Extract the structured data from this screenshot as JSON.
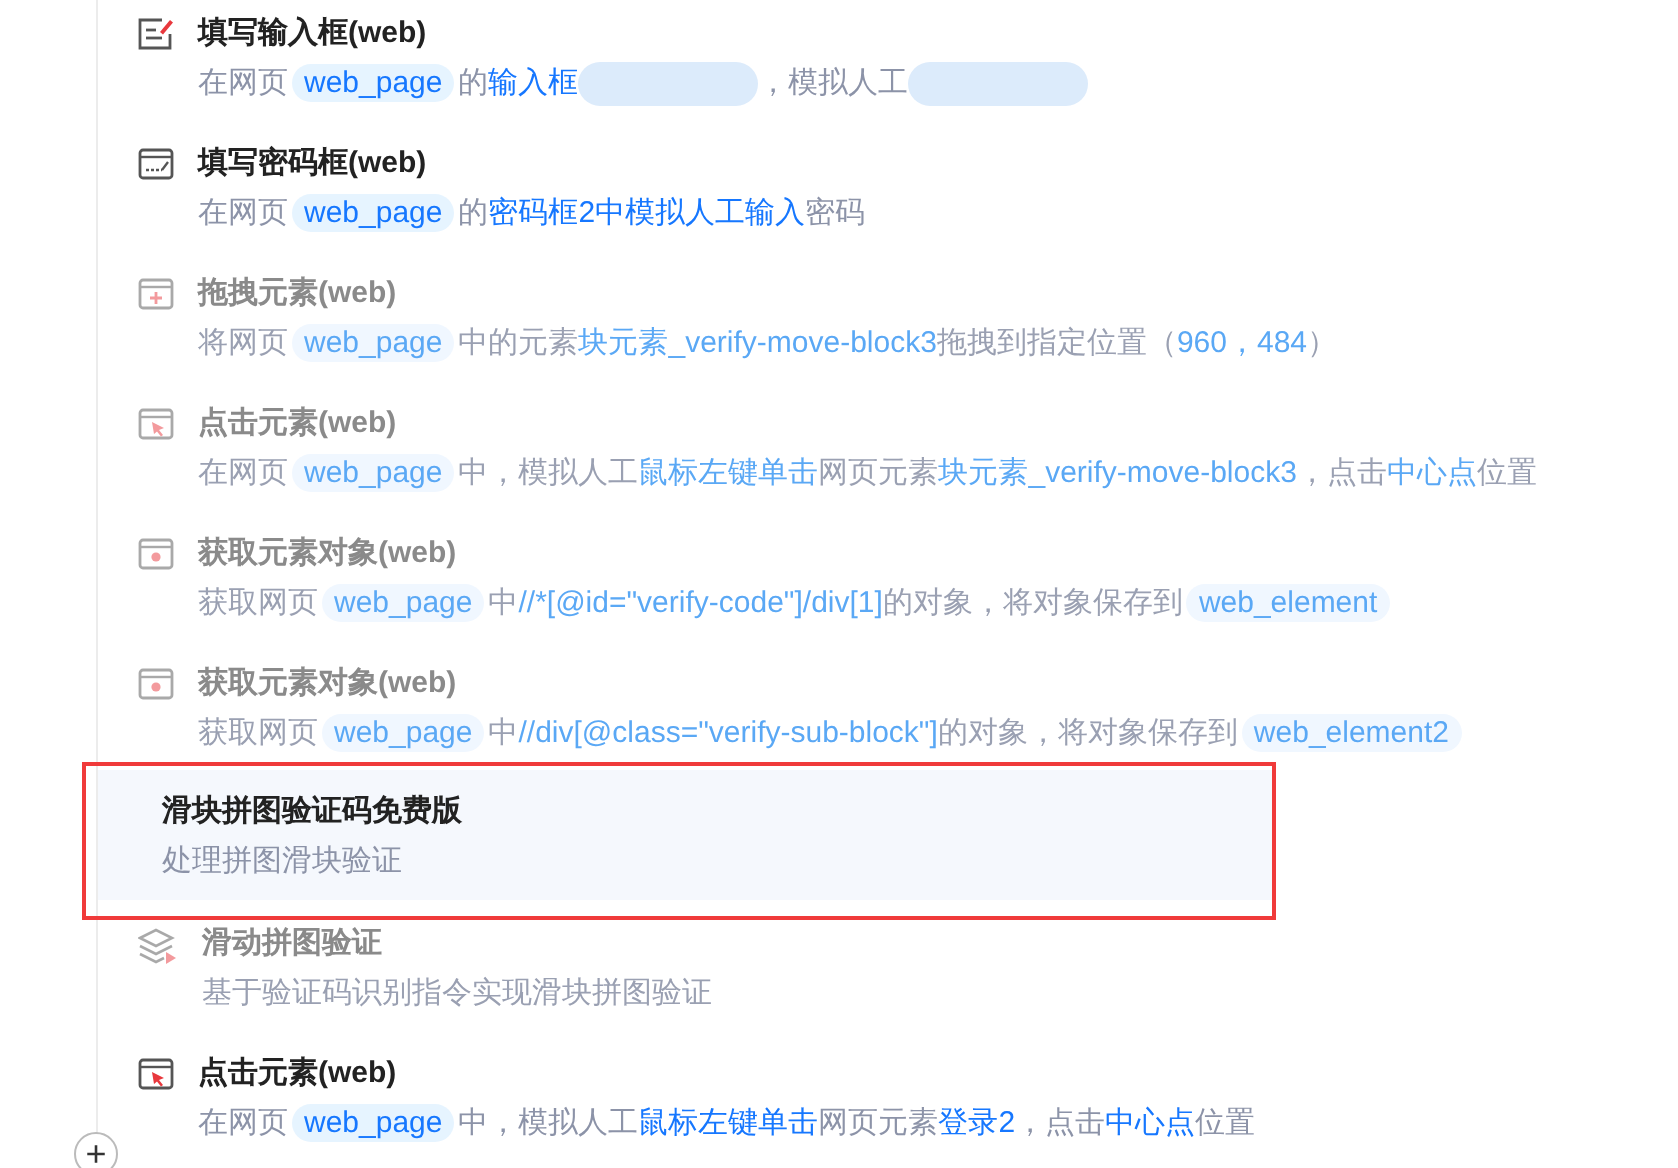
{
  "steps": [
    {
      "kind": "input",
      "title": "填写输入框(web)",
      "disabled": false,
      "selected": false,
      "annotated": false,
      "description": [
        {
          "kind": "text",
          "text": "在网页"
        },
        {
          "kind": "chip",
          "text": "web_page"
        },
        {
          "kind": "text",
          "text": "的"
        },
        {
          "kind": "link",
          "text": "输入框"
        },
        {
          "kind": "blur"
        },
        {
          "kind": "text",
          "text": "，模拟人工"
        },
        {
          "kind": "blur"
        }
      ]
    },
    {
      "kind": "password",
      "title": "填写密码框(web)",
      "disabled": false,
      "selected": false,
      "annotated": false,
      "description": [
        {
          "kind": "text",
          "text": "在网页"
        },
        {
          "kind": "chip",
          "text": "web_page"
        },
        {
          "kind": "text",
          "text": "的"
        },
        {
          "kind": "link",
          "text": "密码框2中模拟人工输入"
        },
        {
          "kind": "text",
          "text": "密码"
        }
      ]
    },
    {
      "kind": "drag",
      "title": "拖拽元素(web)",
      "disabled": true,
      "selected": false,
      "annotated": false,
      "description": [
        {
          "kind": "text",
          "text": "将网页"
        },
        {
          "kind": "chip",
          "text": "web_page"
        },
        {
          "kind": "text",
          "text": "中的元素"
        },
        {
          "kind": "link",
          "text": "块元素_verify-move-block3"
        },
        {
          "kind": "text",
          "text": "拖拽到指定位置（"
        },
        {
          "kind": "link",
          "text": "960，484"
        },
        {
          "kind": "text",
          "text": "）"
        }
      ]
    },
    {
      "kind": "click",
      "title": "点击元素(web)",
      "disabled": true,
      "selected": false,
      "annotated": false,
      "description": [
        {
          "kind": "text",
          "text": "在网页"
        },
        {
          "kind": "chip",
          "text": "web_page"
        },
        {
          "kind": "text",
          "text": "中，模拟人工"
        },
        {
          "kind": "link",
          "text": "鼠标左键单击"
        },
        {
          "kind": "text",
          "text": "网页元素"
        },
        {
          "kind": "link",
          "text": "块元素_verify-move-block3"
        },
        {
          "kind": "text",
          "text": "，点击"
        },
        {
          "kind": "link",
          "text": "中心点"
        },
        {
          "kind": "text",
          "text": "位置"
        }
      ]
    },
    {
      "kind": "element",
      "title": "获取元素对象(web)",
      "disabled": true,
      "selected": false,
      "annotated": false,
      "description": [
        {
          "kind": "text",
          "text": "获取网页"
        },
        {
          "kind": "chip",
          "text": "web_page"
        },
        {
          "kind": "text",
          "text": "中"
        },
        {
          "kind": "link",
          "text": "//*[@id=\"verify-code\"]/div[1]"
        },
        {
          "kind": "text",
          "text": "的对象，将对象保存到"
        },
        {
          "kind": "chip",
          "text": "web_element"
        }
      ]
    },
    {
      "kind": "element",
      "title": "获取元素对象(web)",
      "disabled": true,
      "selected": false,
      "annotated": false,
      "description": [
        {
          "kind": "text",
          "text": "获取网页"
        },
        {
          "kind": "chip",
          "text": "web_page"
        },
        {
          "kind": "text",
          "text": "中"
        },
        {
          "kind": "link",
          "text": "//div[@class=\"verify-sub-block\"]"
        },
        {
          "kind": "text",
          "text": "的对象，将对象保存到"
        },
        {
          "kind": "chip",
          "text": "web_element2"
        }
      ]
    },
    {
      "kind": "none",
      "title": "滑块拼图验证码免费版",
      "disabled": false,
      "selected": true,
      "annotated": true,
      "description": [
        {
          "kind": "text",
          "text": "处理拼图滑块验证"
        }
      ]
    },
    {
      "kind": "layers",
      "title": "滑动拼图验证",
      "disabled": true,
      "selected": false,
      "annotated": false,
      "description": [
        {
          "kind": "text",
          "text": "基于验证码识别指令实现滑块拼图验证"
        }
      ]
    },
    {
      "kind": "click",
      "title": "点击元素(web)",
      "disabled": false,
      "selected": false,
      "annotated": false,
      "description": [
        {
          "kind": "text",
          "text": "在网页"
        },
        {
          "kind": "chip",
          "text": "web_page"
        },
        {
          "kind": "text",
          "text": "中，模拟人工"
        },
        {
          "kind": "link",
          "text": "鼠标左键单击"
        },
        {
          "kind": "text",
          "text": "网页元素"
        },
        {
          "kind": "link",
          "text": "登录2"
        },
        {
          "kind": "text",
          "text": "，点击"
        },
        {
          "kind": "link",
          "text": "中心点"
        },
        {
          "kind": "text",
          "text": "位置"
        }
      ]
    }
  ],
  "add_button": {
    "label": "+"
  }
}
